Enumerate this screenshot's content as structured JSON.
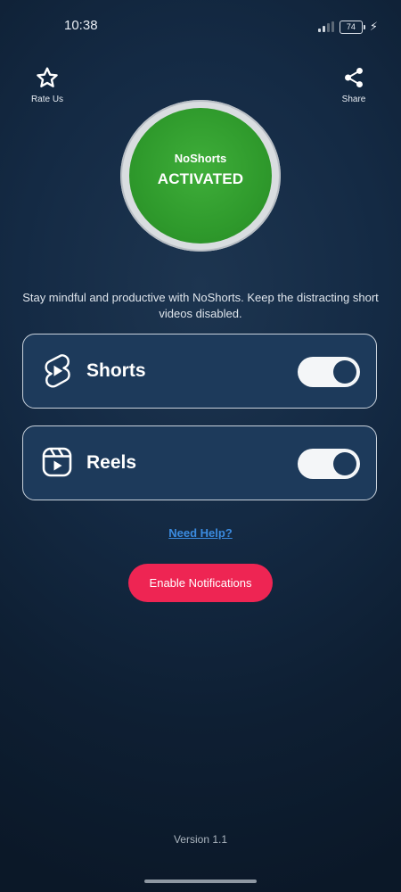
{
  "status_bar": {
    "time": "10:38",
    "battery": "74",
    "icons": [
      "signal-icon",
      "battery-icon",
      "charging-icon"
    ]
  },
  "header": {
    "rate_label": "Rate Us",
    "rate_icon": "star-icon",
    "share_label": "Share",
    "share_icon": "share-icon"
  },
  "status_circle": {
    "app_name": "NoShorts",
    "state": "ACTIVATED",
    "color": "#2f9a2c"
  },
  "tagline": "Stay mindful and productive with NoShorts. Keep the distracting short videos disabled.",
  "features": [
    {
      "label": "Shorts",
      "icon": "shorts-icon",
      "enabled": true
    },
    {
      "label": "Reels",
      "icon": "reels-icon",
      "enabled": true
    }
  ],
  "help_link": "Need Help?",
  "notifications_button": "Enable Notifications",
  "version": "Version 1.1",
  "colors": {
    "accent": "#ee2553",
    "link": "#3b8be0",
    "card": "#1d3a5b",
    "background": "#142a44"
  }
}
